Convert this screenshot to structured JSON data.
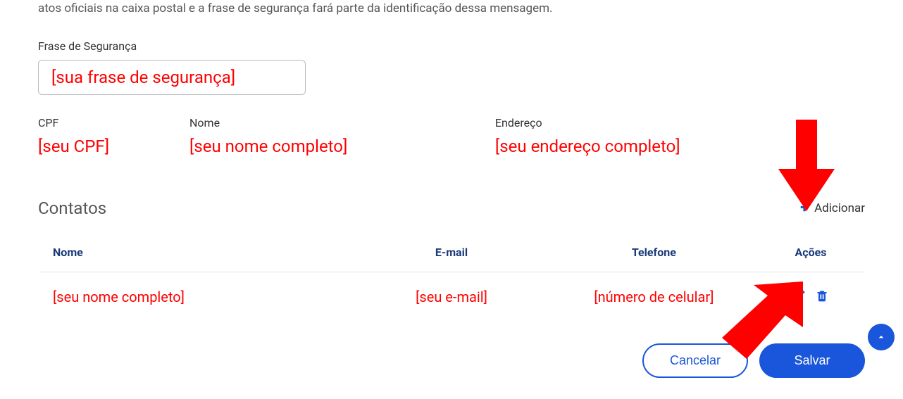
{
  "intro": "atos oficiais na caixa postal e a frase de segurança fará parte da identificação dessa mensagem.",
  "security": {
    "label": "Frase de Segurança",
    "value": "[sua frase de segurança]"
  },
  "fields": {
    "cpf": {
      "label": "CPF",
      "value": "[seu CPF]"
    },
    "nome": {
      "label": "Nome",
      "value": "[seu nome completo]"
    },
    "endereco": {
      "label": "Endereço",
      "value": "[seu endereço completo]"
    }
  },
  "contacts": {
    "title": "Contatos",
    "add_label": "Adicionar",
    "headers": {
      "nome": "Nome",
      "email": "E-mail",
      "telefone": "Telefone",
      "acoes": "Ações"
    },
    "rows": [
      {
        "nome": "[seu nome completo]",
        "email": "[seu e-mail]",
        "telefone": "[número de celular]"
      }
    ]
  },
  "buttons": {
    "cancel": "Cancelar",
    "save": "Salvar"
  }
}
